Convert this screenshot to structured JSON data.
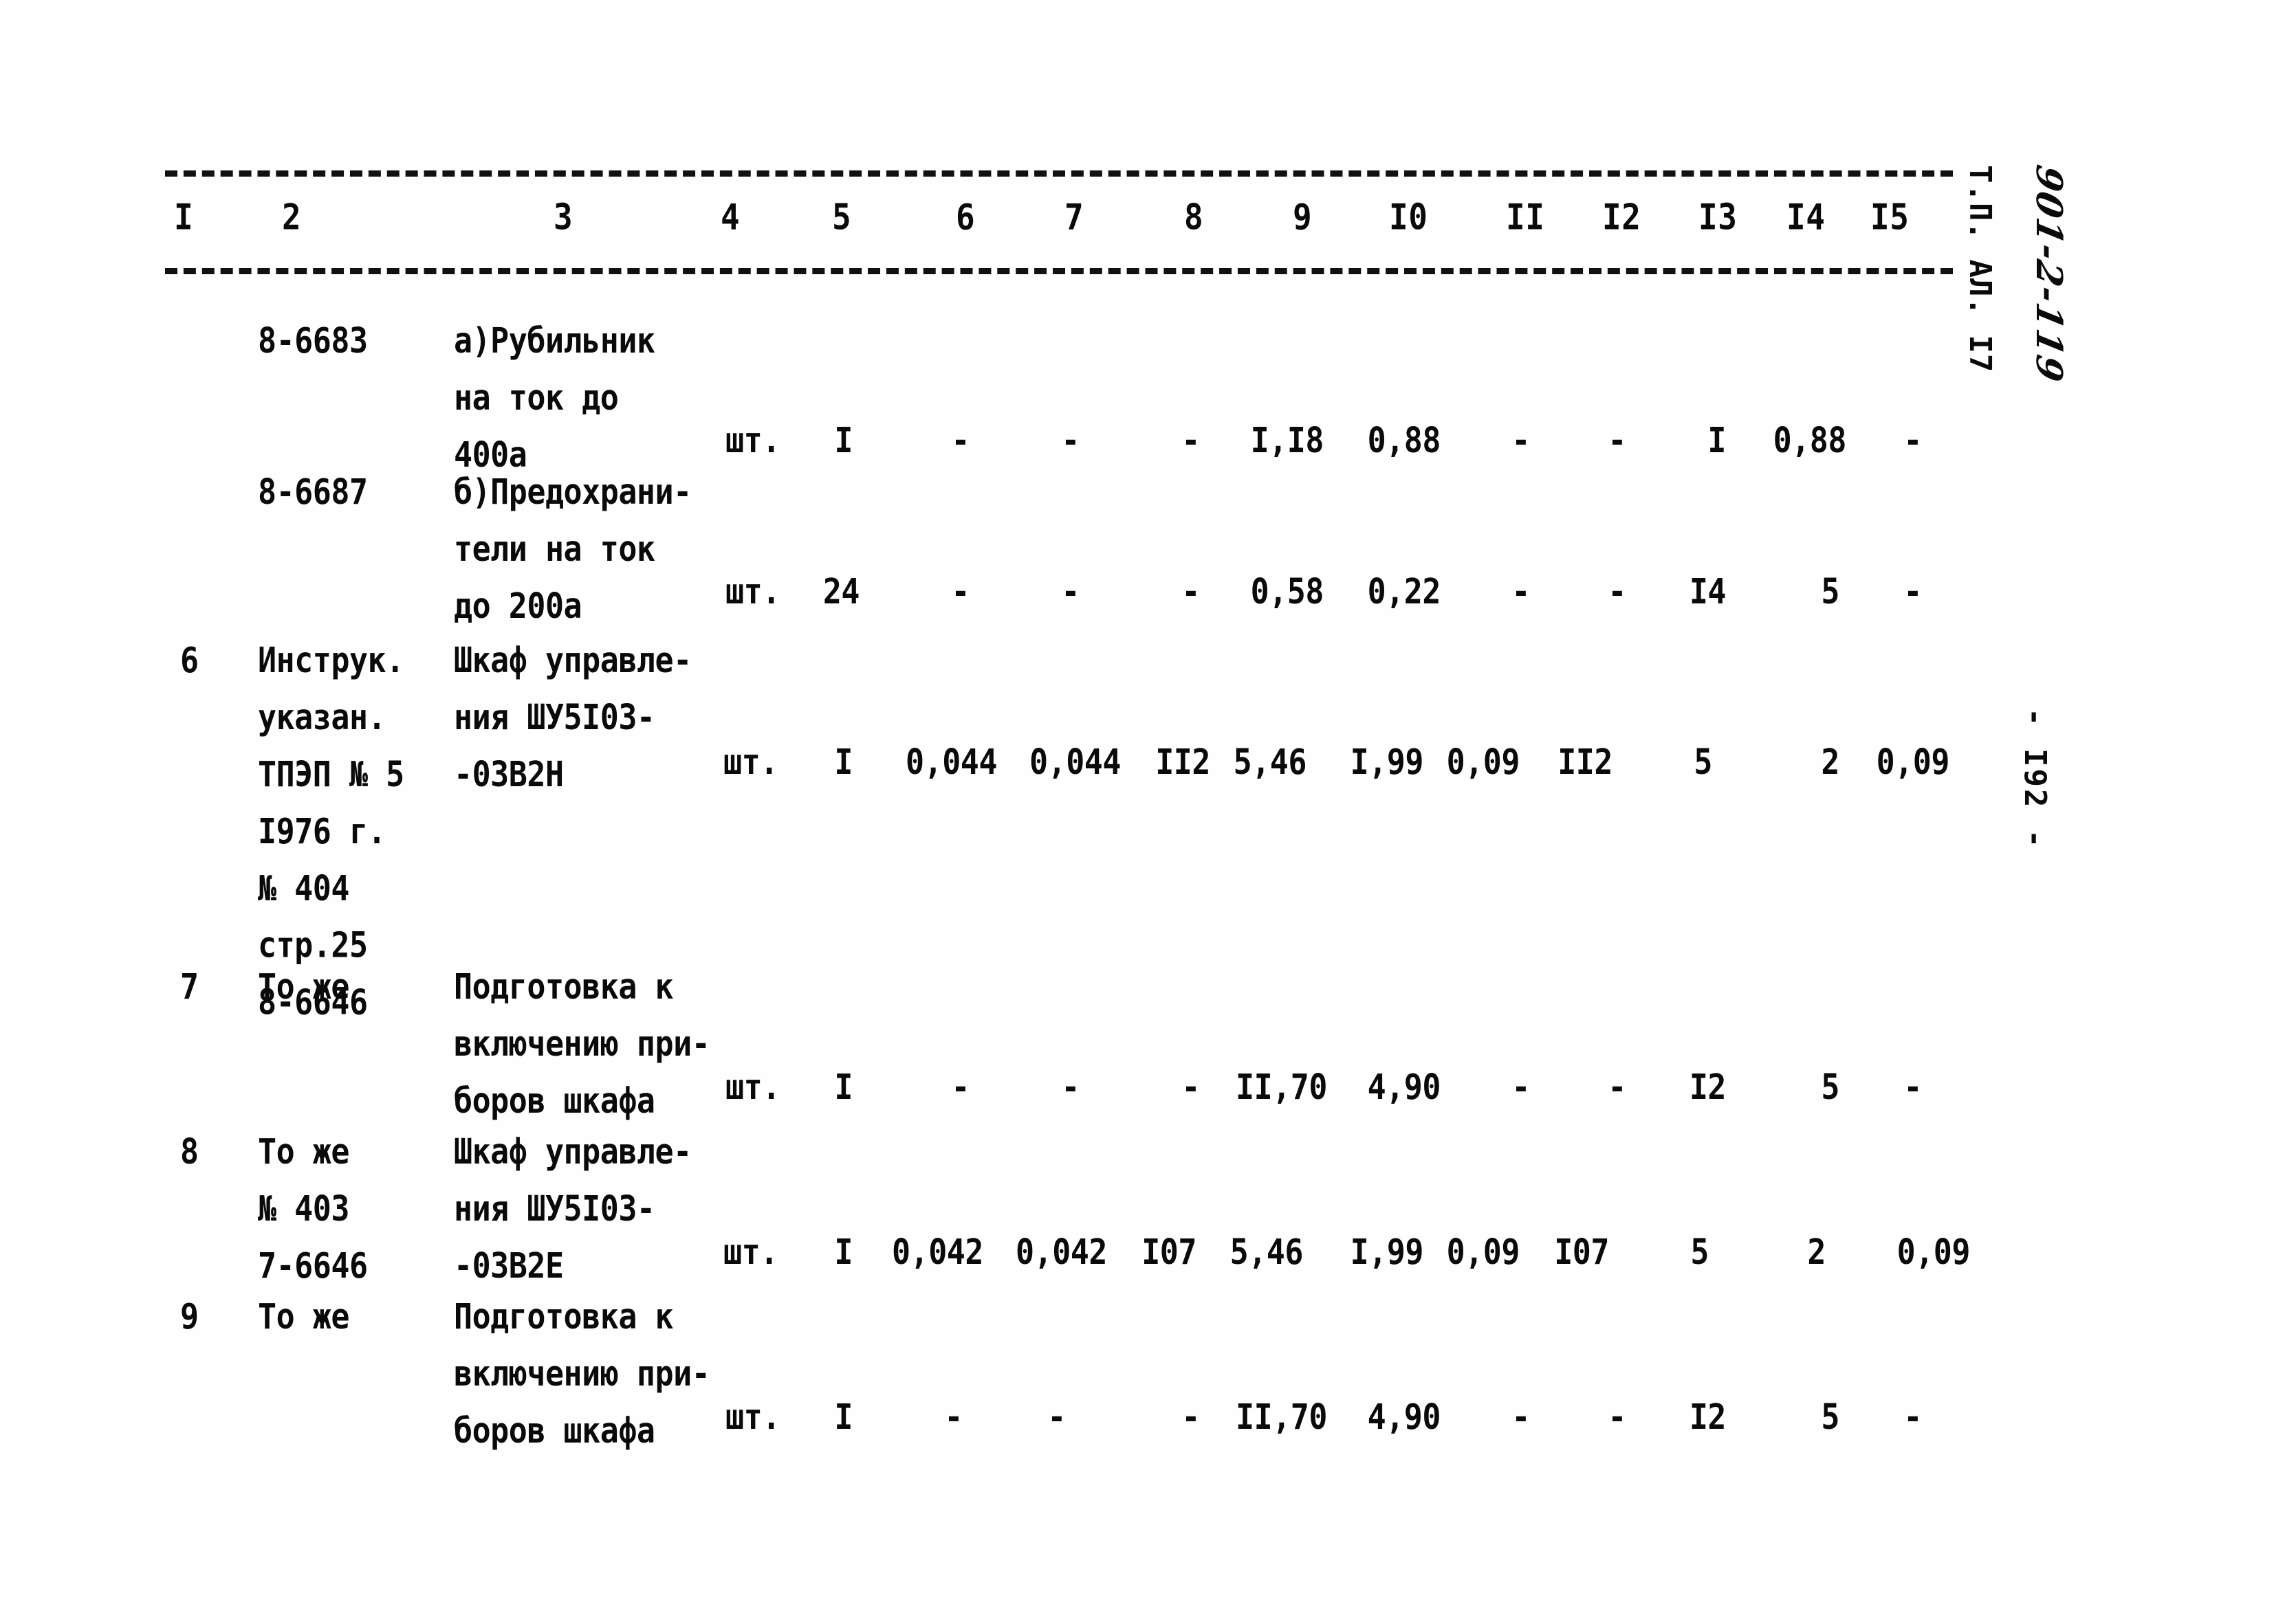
{
  "document": {
    "code_typed": "Т.П. АЛ. I7",
    "code_handwritten": "901-2-119",
    "page_number": "- I92 -"
  },
  "table": {
    "column_headers": [
      "I",
      "2",
      "3",
      "4",
      "5",
      "6",
      "7",
      "8",
      "9",
      "I0",
      "II",
      "I2",
      "I3",
      "I4",
      "I5"
    ],
    "rows": [
      {
        "c1": "",
        "c2": "8-6683",
        "c3": [
          "а)Рубильник",
          "на ток до",
          "400а"
        ],
        "c4": "шт.",
        "c5": "I",
        "c6": "-",
        "c7": "-",
        "c8": "-",
        "c9": "I,I8",
        "c10": "0,88",
        "c11": "-",
        "c12": "-",
        "c13": "I",
        "c14": "0,88",
        "c15": "-"
      },
      {
        "c1": "",
        "c2": "8-6687",
        "c3": [
          "б)Предохрани-",
          "тели на ток",
          "до 200а"
        ],
        "c4": "шт.",
        "c5": "24",
        "c6": "-",
        "c7": "-",
        "c8": "-",
        "c9": "0,58",
        "c10": "0,22",
        "c11": "-",
        "c12": "-",
        "c13": "I4",
        "c14": "5",
        "c15": "-"
      },
      {
        "c1": "6",
        "c2": [
          "Инструк.",
          "указан.",
          "ТПЭП № 5",
          "I976 г.",
          "№ 404",
          "стр.25",
          "8-6646"
        ],
        "c3": [
          "Шкаф управле-",
          "ния ШУ5I03-",
          "-03В2Н"
        ],
        "c4": "шт.",
        "c5": "I",
        "c6": "0,044",
        "c7": "0,044",
        "c8": "II2",
        "c9": "5,46",
        "c10": "I,99",
        "c11": "0,09",
        "c12": "II2",
        "c13": "5",
        "c14": "2",
        "c15": "0,09"
      },
      {
        "c1": "7",
        "c2": [
          "То же"
        ],
        "c3": [
          "Подготовка к",
          "включению при-",
          "боров шкафа"
        ],
        "c4": "шт.",
        "c5": "I",
        "c6": "-",
        "c7": "-",
        "c8": "-",
        "c9": "II,70",
        "c10": "4,90",
        "c11": "-",
        "c12": "-",
        "c13": "I2",
        "c14": "5",
        "c15": "-"
      },
      {
        "c1": "8",
        "c2": [
          "То же",
          "№ 403",
          "7-6646"
        ],
        "c3": [
          "Шкаф управле-",
          "ния ШУ5I03-",
          "-03В2Е"
        ],
        "c4": "шт.",
        "c5": "I",
        "c6": "0,042",
        "c7": "0,042",
        "c8": "I07",
        "c9": "5,46",
        "c10": "I,99",
        "c11": "0,09",
        "c12": "I07",
        "c13": "5",
        "c14": "2",
        "c15": "0,09"
      },
      {
        "c1": "9",
        "c2": [
          "То же"
        ],
        "c3": [
          "Подготовка к",
          "включению при-",
          "боров шкафа"
        ],
        "c4": "шт.",
        "c5": "I",
        "c6": "-",
        "c7": "-",
        "c8": "-",
        "c9": "II,70",
        "c10": "4,90",
        "c11": "-",
        "c12": "-",
        "c13": "I2",
        "c14": "5",
        "c15": "-"
      }
    ]
  }
}
